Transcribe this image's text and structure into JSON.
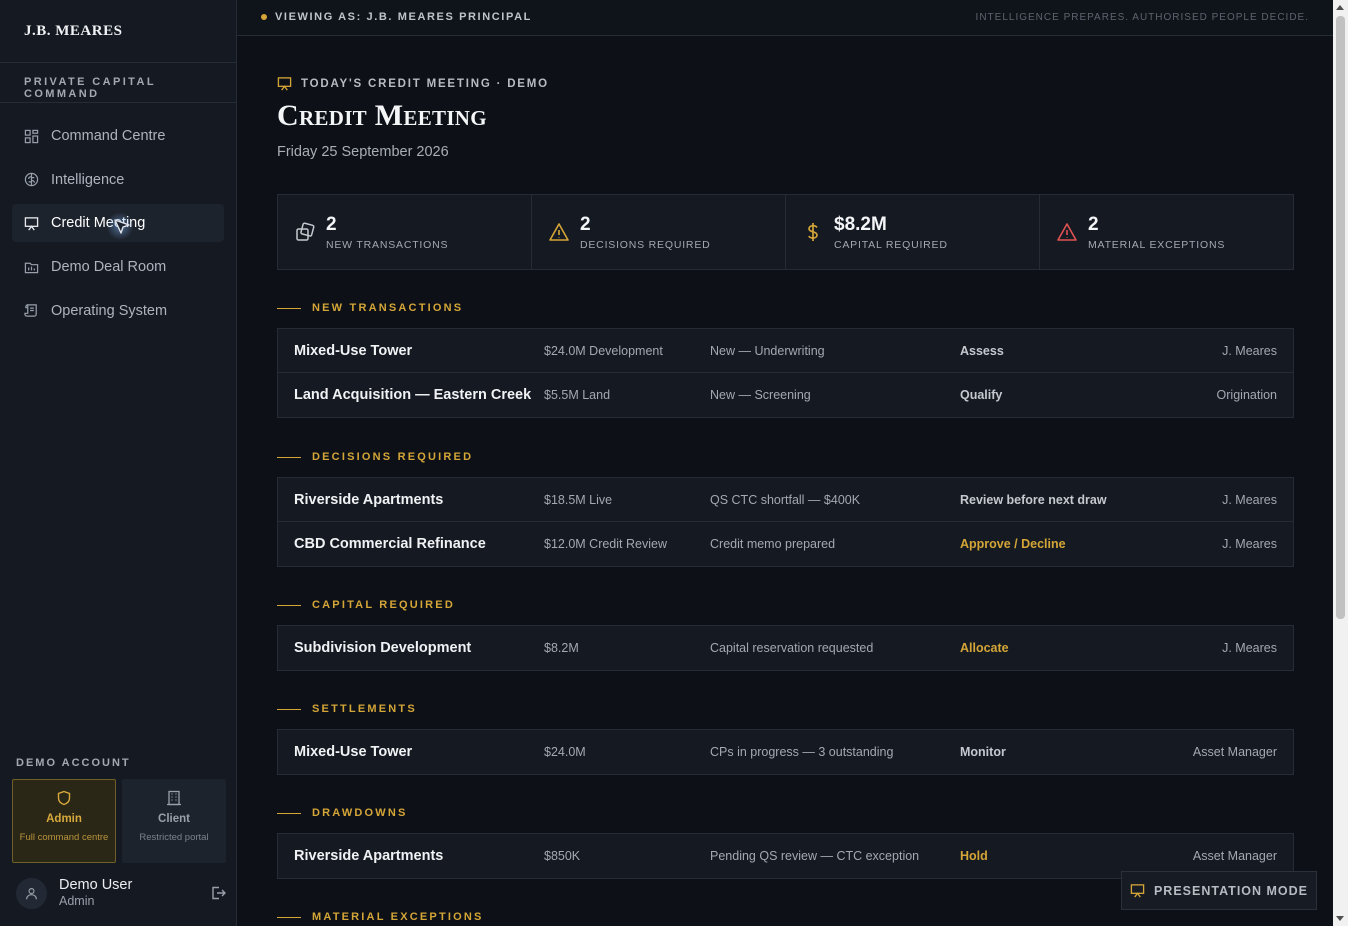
{
  "sidebar": {
    "logo": "J.B. MEARES",
    "subtitle": "PRIVATE CAPITAL COMMAND",
    "nav": [
      {
        "label": "Command Centre",
        "icon": "dashboard-icon"
      },
      {
        "label": "Intelligence",
        "icon": "brain-icon"
      },
      {
        "label": "Credit Meeting",
        "icon": "presentation-icon",
        "active": true
      },
      {
        "label": "Demo Deal Room",
        "icon": "folder-icon"
      },
      {
        "label": "Operating System",
        "icon": "scroll-icon"
      }
    ],
    "demo_label": "DEMO ACCOUNT",
    "roles": [
      {
        "name": "Admin",
        "desc": "Full command centre",
        "icon": "shield-icon",
        "selected": true
      },
      {
        "name": "Client",
        "desc": "Restricted portal",
        "icon": "building-icon",
        "selected": false
      }
    ],
    "user": {
      "name": "Demo User",
      "role": "Admin"
    }
  },
  "topbar": {
    "viewing": "VIEWING AS: J.B. MEARES PRINCIPAL",
    "tagline": "INTELLIGENCE PREPARES. AUTHORISED PEOPLE DECIDE."
  },
  "page": {
    "eyebrow": "TODAY'S CREDIT MEETING · DEMO",
    "title": "Credit Meeting",
    "date": "Friday 25 September 2026"
  },
  "stats": [
    {
      "value": "2",
      "label": "NEW TRANSACTIONS",
      "icon": "copy-icon",
      "color": "#c5c9cf"
    },
    {
      "value": "2",
      "label": "DECISIONS REQUIRED",
      "icon": "warning-icon",
      "color": "#d4a537"
    },
    {
      "value": "$8.2M",
      "label": "CAPITAL REQUIRED",
      "icon": "dollar-icon",
      "color": "#d4a537"
    },
    {
      "value": "2",
      "label": "MATERIAL EXCEPTIONS",
      "icon": "alert-icon",
      "color": "#e05252"
    }
  ],
  "sections": [
    {
      "title": "NEW TRANSACTIONS",
      "rows": [
        {
          "name": "Mixed-Use Tower",
          "amount": "$24.0M Development",
          "status": "New — Underwriting",
          "action": "Assess",
          "gold": false,
          "owner": "J. Meares"
        },
        {
          "name": "Land Acquisition — Eastern Creek",
          "amount": "$5.5M Land",
          "status": "New — Screening",
          "action": "Qualify",
          "gold": false,
          "owner": "Origination"
        }
      ]
    },
    {
      "title": "DECISIONS REQUIRED",
      "rows": [
        {
          "name": "Riverside Apartments",
          "amount": "$18.5M Live",
          "status": "QS CTC shortfall — $400K",
          "action": "Review before next draw",
          "gold": false,
          "owner": "J. Meares"
        },
        {
          "name": "CBD Commercial Refinance",
          "amount": "$12.0M Credit Review",
          "status": "Credit memo prepared",
          "action": "Approve / Decline",
          "gold": true,
          "owner": "J. Meares"
        }
      ]
    },
    {
      "title": "CAPITAL REQUIRED",
      "rows": [
        {
          "name": "Subdivision Development",
          "amount": "$8.2M",
          "status": "Capital reservation requested",
          "action": "Allocate",
          "gold": true,
          "owner": "J. Meares"
        }
      ]
    },
    {
      "title": "SETTLEMENTS",
      "rows": [
        {
          "name": "Mixed-Use Tower",
          "amount": "$24.0M",
          "status": "CPs in progress — 3 outstanding",
          "action": "Monitor",
          "gold": false,
          "owner": "Asset Manager"
        }
      ]
    },
    {
      "title": "DRAWDOWNS",
      "rows": [
        {
          "name": "Riverside Apartments",
          "amount": "$850K",
          "status": "Pending QS review — CTC exception",
          "action": "Hold",
          "gold": true,
          "owner": "Asset Manager"
        }
      ]
    },
    {
      "title": "MATERIAL EXCEPTIONS",
      "rows": []
    }
  ],
  "present_button": "PRESENTATION MODE"
}
